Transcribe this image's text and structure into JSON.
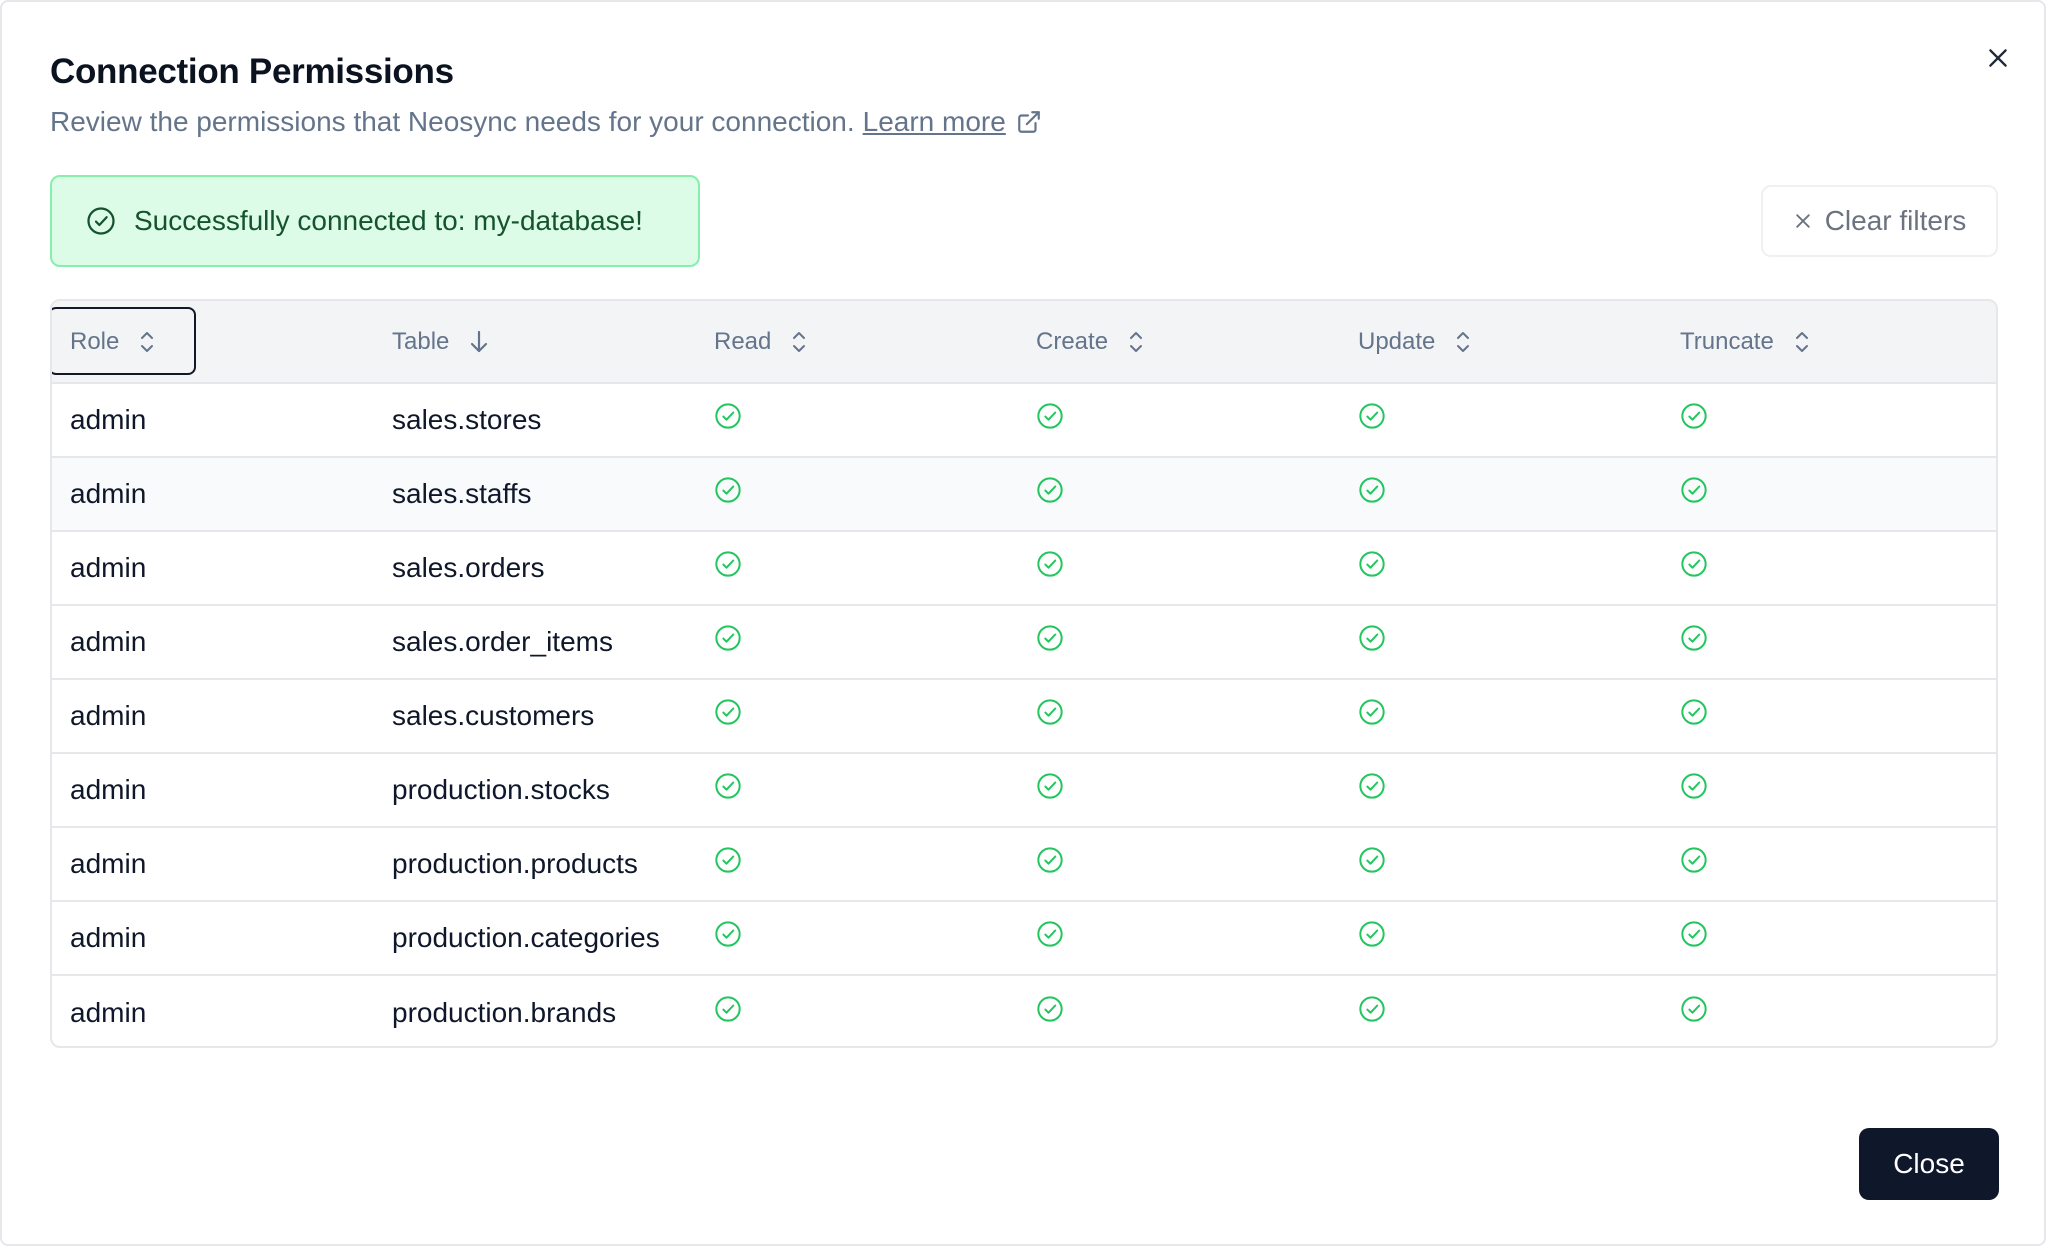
{
  "dialog": {
    "title": "Connection Permissions",
    "subtitle": "Review the permissions that Neosync needs for your connection.",
    "learn_more": "Learn more",
    "alert_text": "Successfully connected to: my-database!",
    "clear_filters": "Clear filters",
    "close_label": "Close"
  },
  "table": {
    "columns": [
      "Role",
      "Table",
      "Read",
      "Create",
      "Update",
      "Truncate"
    ],
    "sort_icons": [
      "sort-icon",
      "arrow-down-icon",
      "sort-icon",
      "sort-icon",
      "sort-icon",
      "sort-icon"
    ],
    "rows": [
      {
        "role": "admin",
        "table": "sales.stores",
        "read": true,
        "create": true,
        "update": true,
        "truncate": true
      },
      {
        "role": "admin",
        "table": "sales.staffs",
        "read": true,
        "create": true,
        "update": true,
        "truncate": true
      },
      {
        "role": "admin",
        "table": "sales.orders",
        "read": true,
        "create": true,
        "update": true,
        "truncate": true
      },
      {
        "role": "admin",
        "table": "sales.order_items",
        "read": true,
        "create": true,
        "update": true,
        "truncate": true
      },
      {
        "role": "admin",
        "table": "sales.customers",
        "read": true,
        "create": true,
        "update": true,
        "truncate": true
      },
      {
        "role": "admin",
        "table": "production.stocks",
        "read": true,
        "create": true,
        "update": true,
        "truncate": true
      },
      {
        "role": "admin",
        "table": "production.products",
        "read": true,
        "create": true,
        "update": true,
        "truncate": true
      },
      {
        "role": "admin",
        "table": "production.categories",
        "read": true,
        "create": true,
        "update": true,
        "truncate": true
      },
      {
        "role": "admin",
        "table": "production.brands",
        "read": true,
        "create": true,
        "update": true,
        "truncate": true
      }
    ]
  },
  "colors": {
    "success": "#22c55e",
    "alert_bg": "#dcfce7",
    "primary_button": "#0f172a"
  }
}
